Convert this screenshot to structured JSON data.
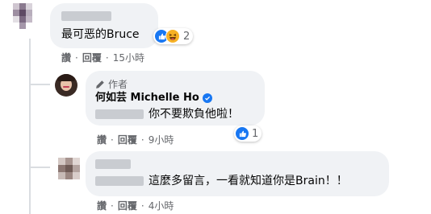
{
  "comments": [
    {
      "text": "最可恶的Bruce",
      "reaction_count": "2",
      "actions": {
        "like": "讚",
        "reply": "回覆",
        "time": "15小時"
      }
    },
    {
      "author_badge": "作者",
      "author_name": "何如芸 Michelle Ho",
      "text": "你不要欺負他啦！",
      "reaction_count": "1",
      "actions": {
        "like": "讚",
        "reply": "回覆",
        "time": "9小時"
      }
    },
    {
      "text": "這麼多留言，一看就知道你是Brain！！",
      "actions": {
        "like": "讚",
        "reply": "回覆",
        "time": "4小時"
      }
    }
  ],
  "separator": "·",
  "colors": {
    "bubble": "#f0f2f5",
    "meta": "#65676b",
    "like_blue": "#1877f2",
    "haha_yellow": "#f7b125"
  },
  "icons": [
    "like-reaction-icon",
    "haha-reaction-icon",
    "pen-icon",
    "verified-badge-icon"
  ]
}
